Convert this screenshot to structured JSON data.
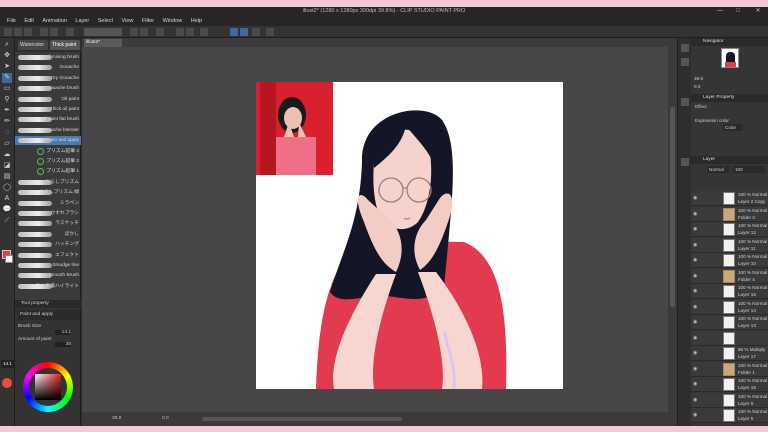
{
  "window": {
    "title": "illust2* (1280 x 1280px 300dpi 39.8%)  - CLIP STUDIO PAINT PRO",
    "minimize": "—",
    "maximize": "□",
    "close": "✕"
  },
  "menu": [
    "File",
    "Edit",
    "Animation",
    "Layer",
    "Select",
    "View",
    "Filter",
    "Window",
    "Help"
  ],
  "canvas_tab": "illust2*",
  "subtool": {
    "tabs": [
      "Watercolor",
      "Thick paint"
    ],
    "brushes": [
      {
        "label": "Oil mixing brush",
        "hl": false
      },
      {
        "label": "Gouache",
        "hl": false
      },
      {
        "label": "Dry Gouache",
        "hl": false
      },
      {
        "label": "Gouache brush",
        "hl": false
      },
      {
        "label": "Oil paint",
        "hl": false
      },
      {
        "label": "Thick oil paint",
        "hl": false
      },
      {
        "label": "Oil paint flat brush",
        "hl": false
      },
      {
        "label": "Gouache blender",
        "hl": false
      },
      {
        "label": "Paint and apply",
        "hl": true
      },
      {
        "label": "プリズム鉛筆 3",
        "hl": false
      },
      {
        "label": "プリズム鉛筆 2",
        "hl": false
      },
      {
        "label": "プリズム鉛筆 1",
        "hl": false
      },
      {
        "label": "ちらしプリズム",
        "hl": false
      },
      {
        "label": "ちらしプリズム 緑",
        "hl": false
      },
      {
        "label": "ミラペン",
        "hl": false
      },
      {
        "label": "かすれブラシ",
        "hl": false
      },
      {
        "label": "ラスケッチ",
        "hl": false
      },
      {
        "label": "ぼかし",
        "hl": false
      },
      {
        "label": "ハッチング",
        "hl": false
      },
      {
        "label": "エフェクト",
        "hl": false
      },
      {
        "label": "Smudge line",
        "hl": false
      },
      {
        "label": "Smooth Brush",
        "hl": false
      },
      {
        "label": "ひも手書ハイライト",
        "hl": false
      }
    ]
  },
  "tool_property": {
    "header": "Tool property",
    "name": "Paint and apply",
    "brush_size_label": "Brush Size",
    "brush_size_value": "14.1",
    "amount_label": "Amount of paint",
    "amount_value": "35"
  },
  "brush_size_readout": "14.1",
  "navigator": {
    "title": "Navigator",
    "zoom": "39.8",
    "angle": "0.0"
  },
  "layer_property": {
    "title": "Layer Property",
    "effect_label": "Effect",
    "expression_label": "Expression color",
    "expression_value": "Color"
  },
  "layer_panel": {
    "title": "Layer",
    "blend": "Normal",
    "opacity": "100"
  },
  "layers": [
    {
      "l1": "100 % Normal",
      "l2": "Layer 2 Copy",
      "folder": false,
      "sel": false
    },
    {
      "l1": "100 % Normal",
      "l2": "Folder 3",
      "folder": true,
      "sel": false
    },
    {
      "l1": "100 % Normal",
      "l2": "Layer 12",
      "folder": false,
      "sel": false
    },
    {
      "l1": "100 % Normal",
      "l2": "Layer 11",
      "folder": false,
      "sel": false
    },
    {
      "l1": "100 % Normal",
      "l2": "Layer 10",
      "folder": false,
      "sel": false
    },
    {
      "l1": "100 % Normal",
      "l2": "Folder 4",
      "folder": true,
      "sel": false
    },
    {
      "l1": "100 % Normal",
      "l2": "Layer 15",
      "folder": false,
      "sel": false
    },
    {
      "l1": "100 % Normal",
      "l2": "Layer 14",
      "folder": false,
      "sel": false
    },
    {
      "l1": "100 % Normal",
      "l2": "Layer 13",
      "folder": false,
      "sel": false
    },
    {
      "l1": "",
      "l2": "",
      "folder": false,
      "sel": false
    },
    {
      "l1": "66 % Multiply",
      "l2": "Layer 17",
      "folder": false,
      "sel": false
    },
    {
      "l1": "100 % Normal",
      "l2": "Folder 1",
      "folder": true,
      "sel": false
    },
    {
      "l1": "100 % Normal",
      "l2": "Layer 18",
      "folder": false,
      "sel": false
    },
    {
      "l1": "100 % Normal",
      "l2": "Layer 6",
      "folder": false,
      "sel": false
    },
    {
      "l1": "100 % Normal",
      "l2": "Layer 5",
      "folder": false,
      "sel": false
    }
  ],
  "status": {
    "zoom": "39.8",
    "angle": "0.0"
  },
  "colors": {
    "paint_red": "#e23a4f",
    "hair": "#141628",
    "skin": "#f6d2cc",
    "wall_red": "#d8202e"
  }
}
